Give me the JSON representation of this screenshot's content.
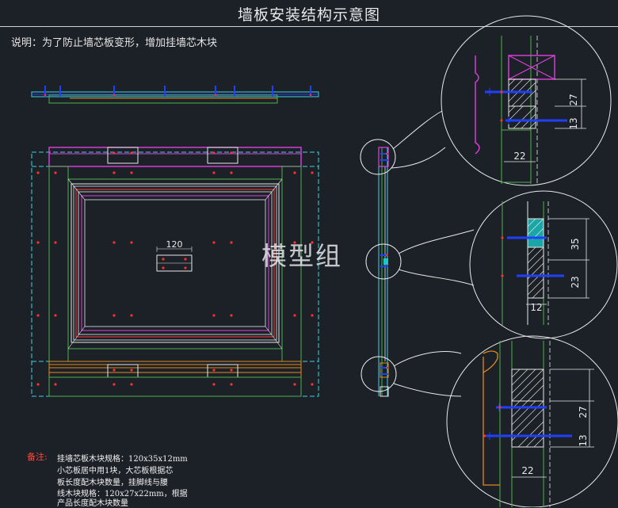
{
  "title": "墙板安装结构示意图",
  "description": "说明：为了防止墙芯板变形，增加挂墙芯木块",
  "watermark": "模型组",
  "center_dimension": "120",
  "notes": {
    "label": "备注:",
    "lines": [
      "挂墙芯板木块规格：120x35x12mm",
      "小芯板居中用1块，大芯板根据芯",
      "板长度配木块数量，挂脚线与腰",
      "线木块规格：120x27x22mm，根据",
      "产品长度配木块数量"
    ]
  },
  "details": [
    {
      "dims": [
        "27",
        "13",
        "22"
      ]
    },
    {
      "dims": [
        "35",
        "23",
        "12"
      ]
    },
    {
      "dims": [
        "27",
        "13",
        "22"
      ]
    }
  ],
  "colors": {
    "background": "#1c2127",
    "cyan": "#3fd3e0",
    "green": "#4fae4f",
    "magenta": "#e040e0",
    "red": "#ff3030",
    "blue": "#2040ff",
    "orange": "#e08a1e"
  }
}
